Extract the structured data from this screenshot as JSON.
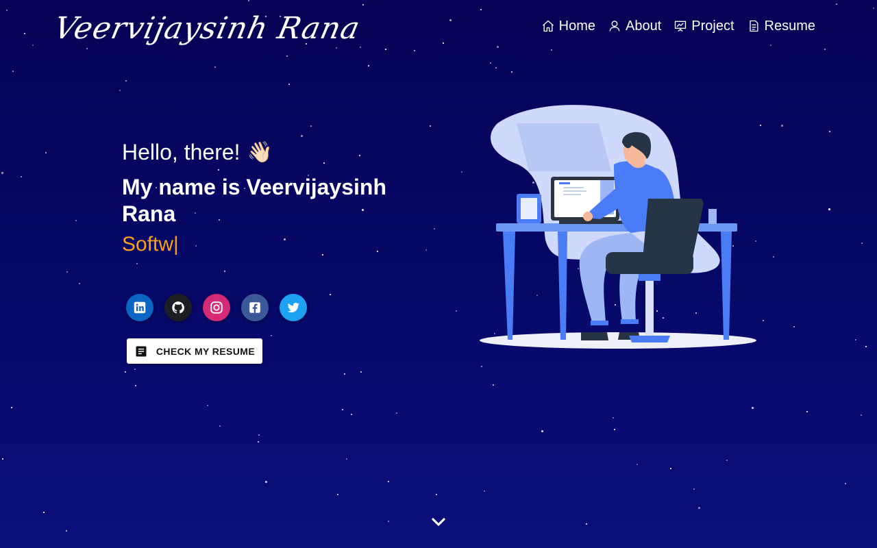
{
  "header": {
    "logo_text": "Veervijaysinh Rana",
    "nav": [
      {
        "label": "Home",
        "icon": "home-icon"
      },
      {
        "label": "About",
        "icon": "user-icon"
      },
      {
        "label": "Project",
        "icon": "presentation-icon"
      },
      {
        "label": "Resume",
        "icon": "document-icon"
      }
    ]
  },
  "hero": {
    "greeting": "Hello, there!",
    "wave_emoji": "👋🏻",
    "name_line": "My name is Veervijaysinh Rana",
    "typed_text": "Softw|",
    "typed_color": "#f7a21a"
  },
  "socials": [
    {
      "name": "linkedin",
      "icon": "linkedin-icon",
      "color": "#0a66c2"
    },
    {
      "name": "github",
      "icon": "github-icon",
      "color": "#1b1f23"
    },
    {
      "name": "instagram",
      "icon": "instagram-icon",
      "color": "#d62976"
    },
    {
      "name": "facebook",
      "icon": "facebook-icon",
      "color": "#3b5998"
    },
    {
      "name": "twitter",
      "icon": "twitter-icon",
      "color": "#1da1f2"
    }
  ],
  "resume_button": {
    "label": "CHECK MY RESUME",
    "icon": "document-icon"
  },
  "scroll_indicator": {
    "icon": "chevron-down-icon"
  },
  "colors": {
    "background": "#06045e",
    "accent": "#f7a21a",
    "illustration_blue": "#4a7cf7"
  }
}
